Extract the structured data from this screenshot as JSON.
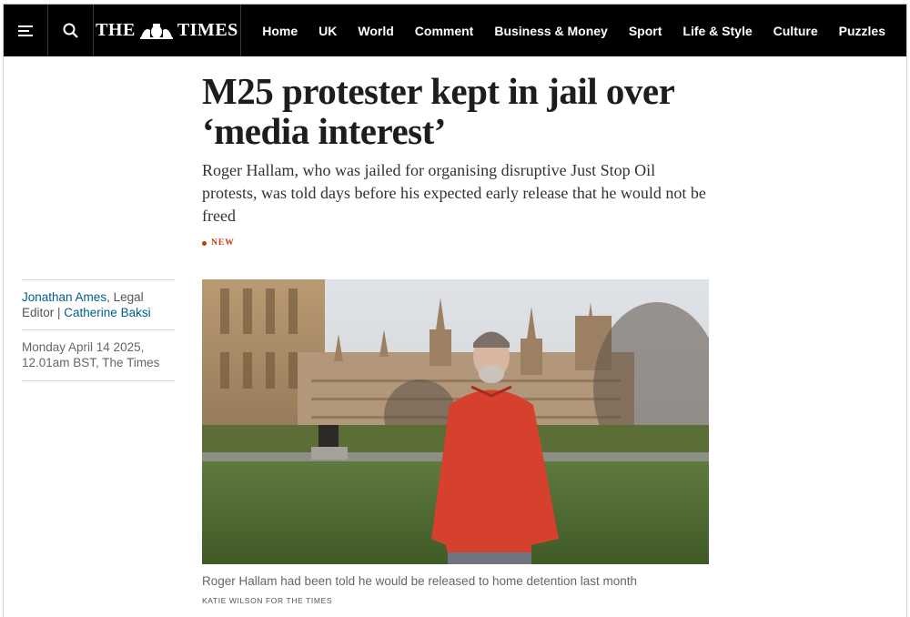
{
  "header": {
    "logo_left": "THE",
    "logo_right": "TIMES",
    "nav": [
      "Home",
      "UK",
      "World",
      "Comment",
      "Business & Money",
      "Sport",
      "Life & Style",
      "Culture",
      "Puzzles"
    ]
  },
  "article": {
    "headline": "M25 protester kept in jail over ‘media interest’",
    "standfirst": "Roger Hallam, who was jailed for organising disruptive Just Stop Oil protests, was told days before his expected early release that he would not be freed",
    "badge": "NEW",
    "byline": {
      "author1": "Jonathan Ames",
      "author1_role": ", Legal Editor | ",
      "author2": "Catherine Baksi"
    },
    "dateline": "Monday April 14 2025, 12.01am BST, The Times",
    "image_caption": "Roger Hallam had been told he would be released to home detention last month",
    "image_credit": "KATIE WILSON FOR THE TIMES"
  },
  "colors": {
    "nav_bg": "#000000",
    "link": "#005d8f",
    "badge": "#c9360b"
  },
  "icons": {
    "menu": "hamburger-menu-icon",
    "search": "search-icon",
    "crest": "royal-crest-icon"
  }
}
